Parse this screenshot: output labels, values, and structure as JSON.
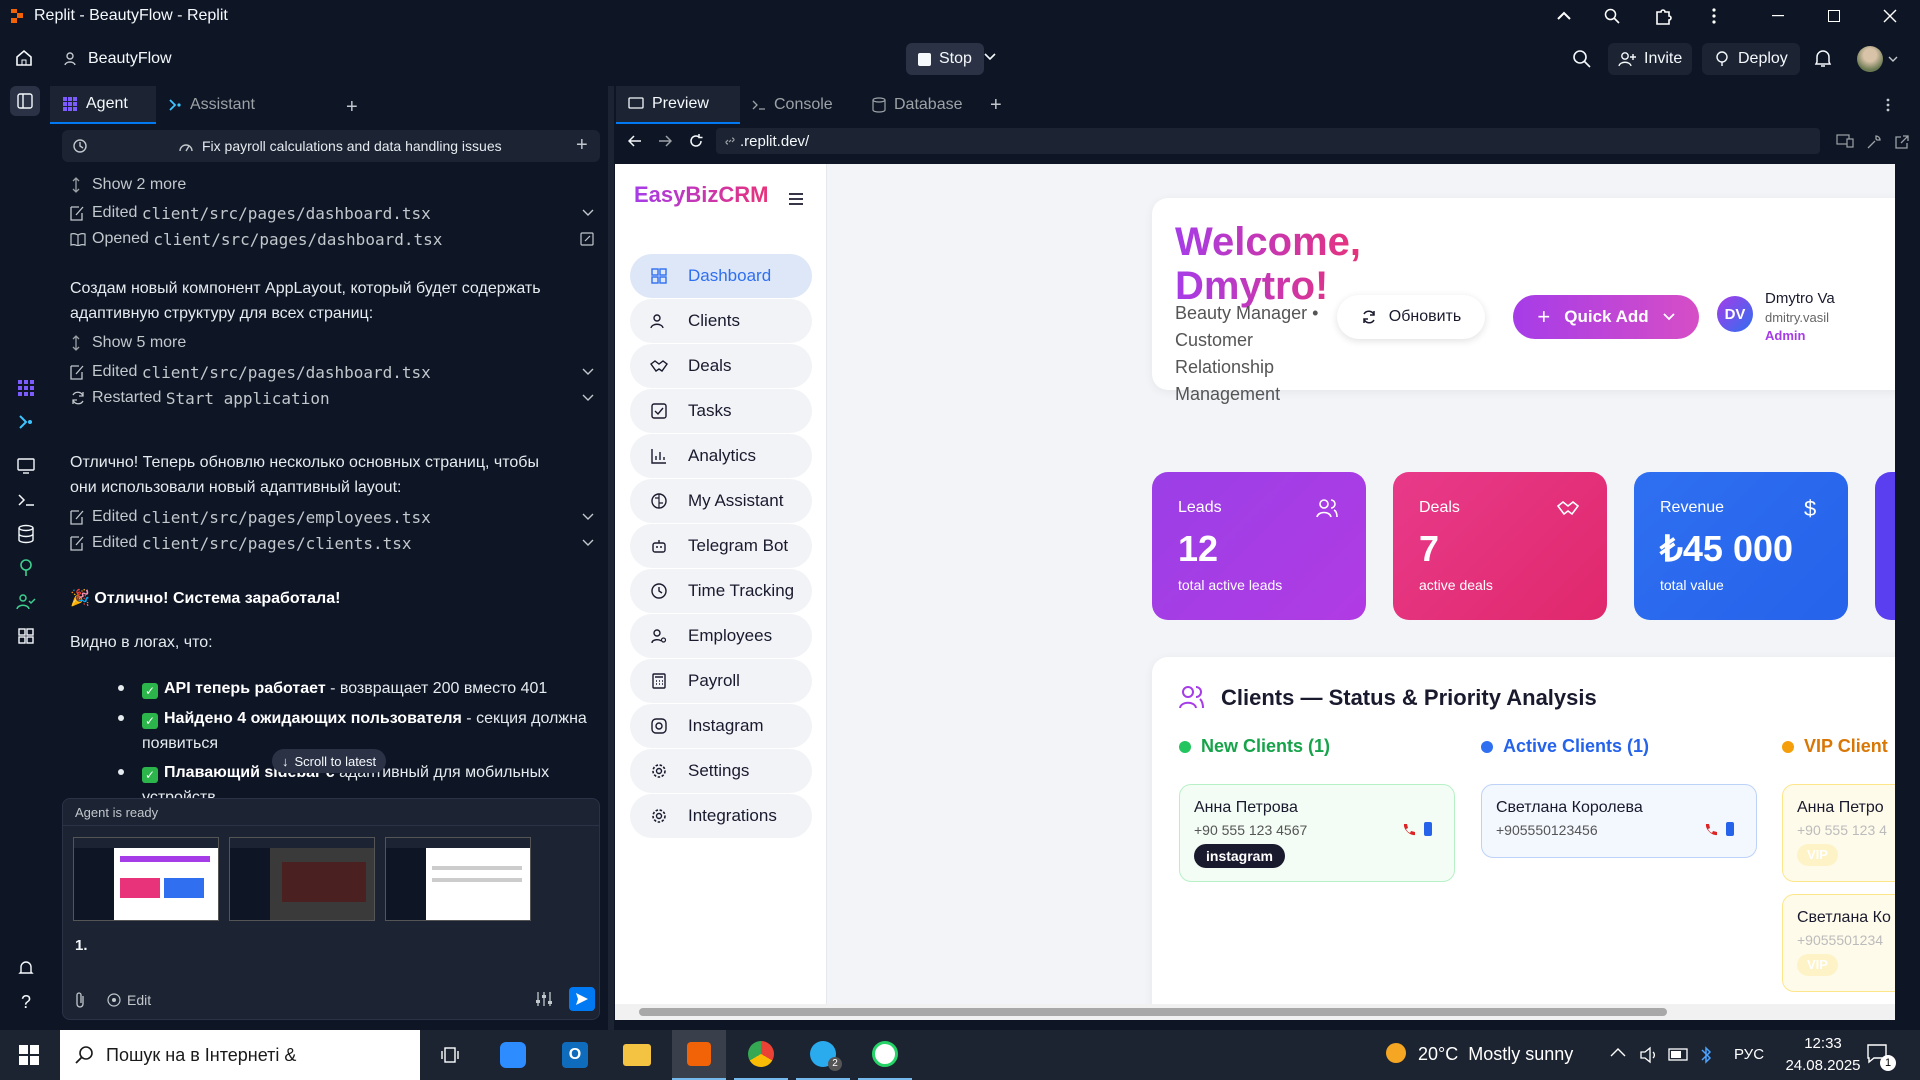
{
  "window": {
    "title": "Replit - BeautyFlow - Replit"
  },
  "appbar": {
    "project": "BeautyFlow",
    "stop": "Stop",
    "invite": "Invite",
    "deploy": "Deploy"
  },
  "agent_panel": {
    "tabs": [
      "Agent",
      "Assistant"
    ],
    "checkpoint": "Fix payroll calculations and data handling issues",
    "items": {
      "show2": "Show 2 more",
      "edited1_label": "Edited",
      "edited1_file": "client/src/pages/dashboard.tsx",
      "opened_label": "Opened",
      "opened_file": "client/src/pages/dashboard.tsx",
      "msg1": "Создам новый компонент AppLayout, который будет содержать адаптивную структуру для всех страниц:",
      "show5": "Show 5 more",
      "edited2_label": "Edited",
      "edited2_file": "client/src/pages/dashboard.tsx",
      "restarted_label": "Restarted",
      "restarted_name": "Start application",
      "msg2": "Отлично! Теперь обновлю несколько основных страниц, чтобы они использовали новый адаптивный layout:",
      "edited3_label": "Edited",
      "edited3_file": "client/src/pages/employees.tsx",
      "edited4_label": "Edited",
      "edited4_file": "client/src/pages/clients.tsx",
      "heading": "Отлично! Система заработала!",
      "logs": "Видно в логах, что:",
      "b1_bold": "API теперь работает",
      "b1_rest": " - возвращает 200 вместо 401",
      "b2_bold": "Найдено 4 ожидающих пользователя",
      "b2_rest": " - секция должна появиться",
      "b3_bold": "Плавающий sidebar с",
      "b3_rest": " адаптивный для мобильных устройств"
    },
    "scroll_to_latest": "Scroll to latest",
    "status": "Agent is ready",
    "input_value": "1.",
    "edit_label": "Edit"
  },
  "preview_panel": {
    "tabs": [
      "Preview",
      "Console",
      "Database"
    ],
    "url": ".replit.dev/"
  },
  "crm": {
    "logo": "EasyBizCRM",
    "nav": [
      "Dashboard",
      "Clients",
      "Deals",
      "Tasks",
      "Analytics",
      "My Assistant",
      "Telegram Bot",
      "Time Tracking",
      "Employees",
      "Payroll",
      "Instagram",
      "Settings",
      "Integrations"
    ],
    "welcome_line1": "Welcome,",
    "welcome_line2": "Dmytro!",
    "subtitle": "Beauty Manager • Customer Relationship Management",
    "refresh": "Обновить",
    "quick_add": "Quick Add",
    "user": {
      "initials": "DV",
      "name": "Dmytro Va",
      "email": "dmitry.vasil",
      "role": "Admin"
    },
    "stats": [
      {
        "label": "Leads",
        "value": "12",
        "sub": "total active leads"
      },
      {
        "label": "Deals",
        "value": "7",
        "sub": "active deals"
      },
      {
        "label": "Revenue",
        "value": "₺45 000",
        "sub": "total value"
      }
    ],
    "clients_title": "Clients — Status & Priority Analysis",
    "columns": [
      "New Clients (1)",
      "Active Clients (1)",
      "VIP Client"
    ],
    "cards": {
      "c1_name": "Анна Петрова",
      "c1_phone": "+90 555 123 4567",
      "c1_tag": "instagram",
      "c2_name": "Светлана Королева",
      "c2_phone": "+905550123456",
      "c3_name": "Анна Петро",
      "c3_phone": "+90 555 123 4",
      "c3_tag": "VIP",
      "c4_name": "Светлана Ко",
      "c4_phone": "+9055501234",
      "c4_tag": "VIP"
    }
  },
  "taskbar": {
    "search": "Пошук на в Інтернеті &",
    "weather": "20°C  Mostly sunny",
    "lang": "РУС",
    "time": "12:33",
    "date": "24.08.2025",
    "notif": "1",
    "telegram_badge": "2"
  },
  "colors": {
    "bg": "#0e1525",
    "accent": "#0079f2",
    "purple": "#a63ce8",
    "pink": "#e8327a",
    "blue": "#2f6ff0"
  }
}
